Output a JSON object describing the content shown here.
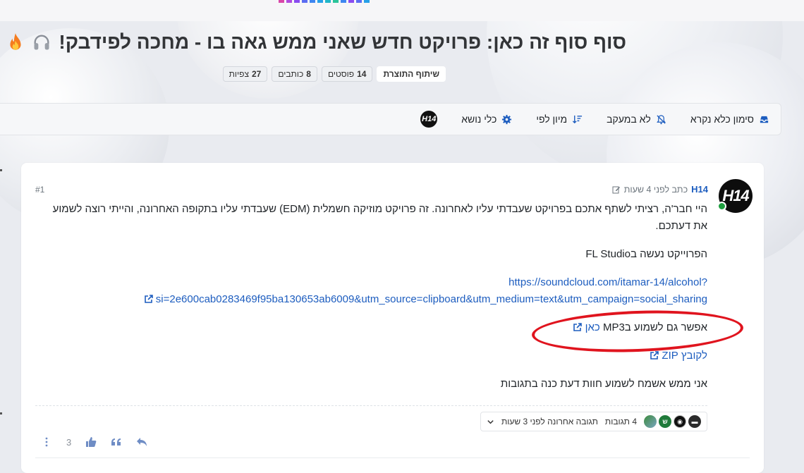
{
  "page": {
    "title": "סוף סוף זה כאן: פרויקט חדש שאני ממש גאה בו - מחכה לפידבק!",
    "title_icons": [
      "headphones-icon",
      "fire-icon"
    ]
  },
  "badges": {
    "category": "שיתוף התוצרת",
    "posts_count": "14",
    "posts_label": "פוסטים",
    "authors_count": "8",
    "authors_label": "כותבים",
    "views_count": "27",
    "views_label": "צפיות"
  },
  "toolbar": {
    "mark_read": "סימון כלא נקרא",
    "not_watching": "לא במעקב",
    "sort_by": "מיון לפי",
    "topic_tools": "כלי נושא",
    "avatar_text": "H14"
  },
  "post": {
    "author": "H14",
    "meta_text": "כתב לפני 4 שעות",
    "index": "#1",
    "avatar_text": "H14",
    "paragraph1": "היי חבר'ה, רציתי לשתף אתכם בפרויקט שעבדתי עליו לאחרונה. זה פרויקט מוזיקה חשמלית (EDM) שעבדתי עליו בתקופה האחרונה, והייתי רוצה לשמוע את דעתכם.",
    "paragraph2": "הפרוייקט נעשה בFL Studio",
    "link_line1": "https://soundcloud.com/itamar-14/alcohol?",
    "link_line2": "si=2e600cab0283469f95ba130653ab6009&utm_source=clipboard&utm_medium=text&utm_campaign=social_sharing",
    "mp3_prefix": "אפשר גם לשמוע בMP3",
    "mp3_link": "כאן",
    "zip_link": "לקובץ ZIP",
    "closing": "אני ממש אשמח לשמוע חוות דעת כנה בתגובות"
  },
  "replies": {
    "count_text": "4 תגובות",
    "last_reply": "תגובה אחרונה לפני 3 שעות",
    "mini_avatar_2": "ש"
  },
  "actions": {
    "votes": "3"
  },
  "colors": {
    "link": "#1d5dbf",
    "annotation": "#e0141e",
    "online": "#1e9e3f"
  }
}
